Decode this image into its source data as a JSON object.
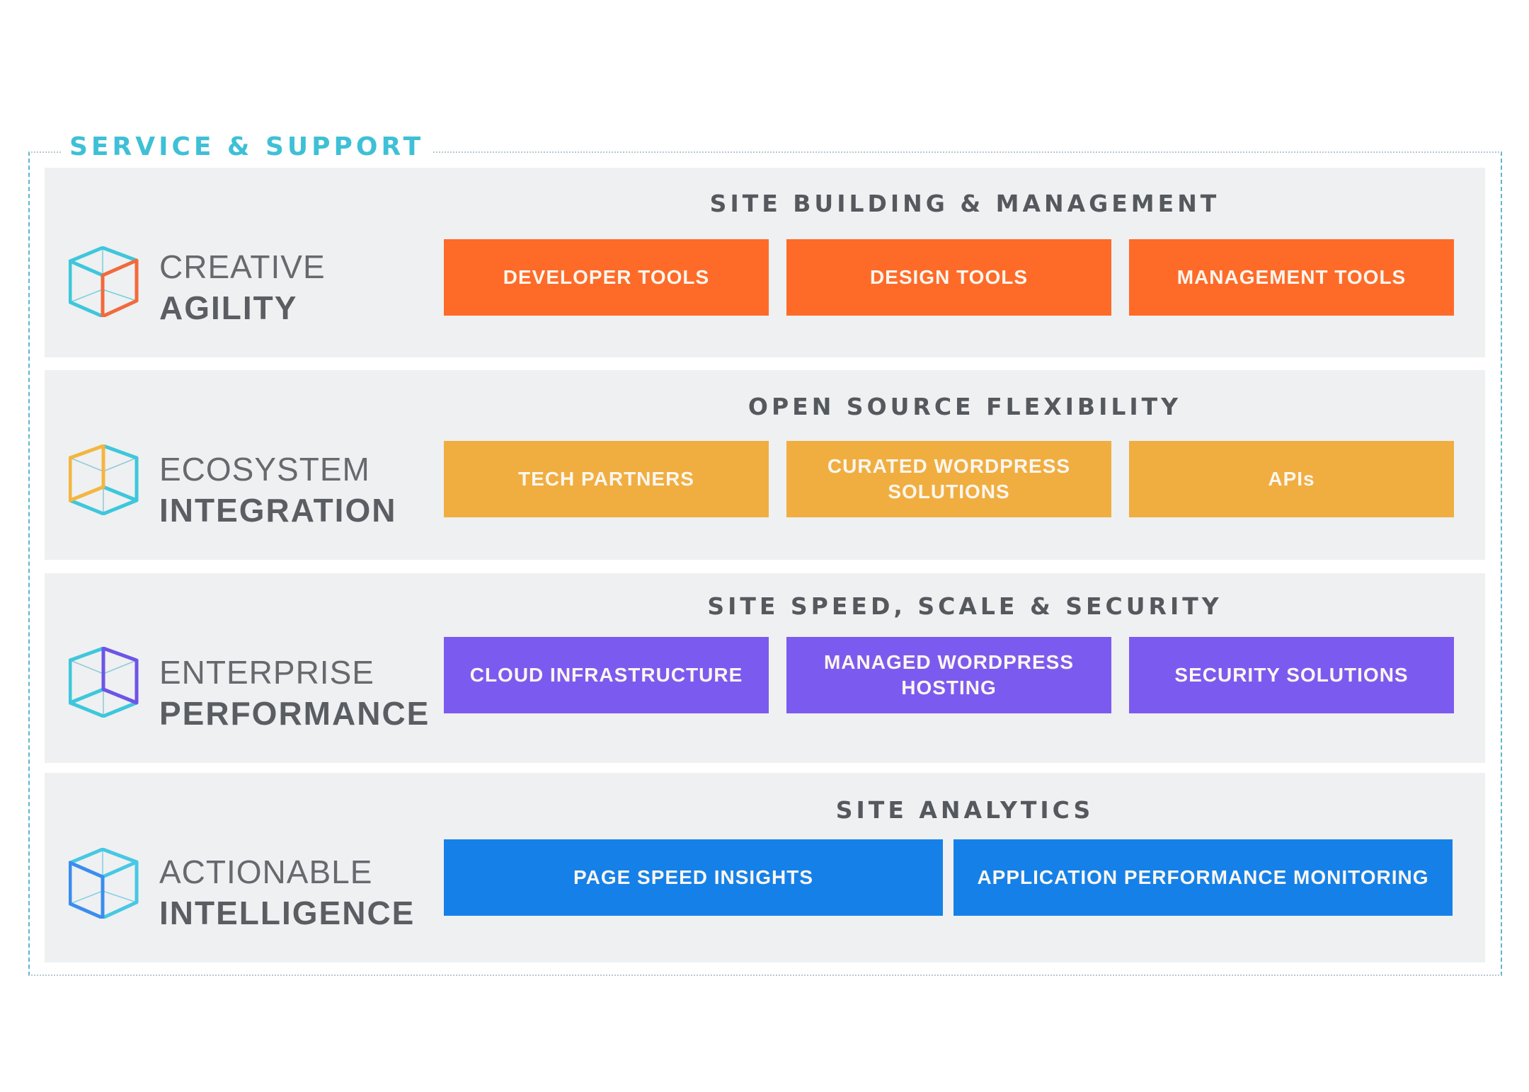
{
  "frame": {
    "title": "SERVICE & SUPPORT",
    "title_color": "#3ec0d6"
  },
  "rows": [
    {
      "label_light": "CREATIVE",
      "label_bold": "AGILITY",
      "icon": "cube-icon",
      "icon_highlight_face": "right",
      "accent": "#fe6b29",
      "section_title": "SITE BUILDING & MANAGEMENT",
      "buttons": [
        {
          "label": "DEVELOPER TOOLS"
        },
        {
          "label": "DESIGN TOOLS"
        },
        {
          "label": "MANAGEMENT TOOLS"
        }
      ]
    },
    {
      "label_light": "ECOSYSTEM",
      "label_bold": "INTEGRATION",
      "icon": "cube-icon",
      "icon_highlight_face": "upper-left",
      "accent": "#f0ae41",
      "section_title": "OPEN SOURCE FLEXIBILITY",
      "buttons": [
        {
          "label": "TECH PARTNERS"
        },
        {
          "label": "CURATED WORDPRESS SOLUTIONS"
        },
        {
          "label": "APIs"
        }
      ]
    },
    {
      "label_light": "ENTERPRISE",
      "label_bold": "PERFORMANCE",
      "icon": "cube-icon",
      "icon_highlight_face": "upper-right",
      "accent": "#7b5bef",
      "section_title": "SITE SPEED, SCALE & SECURITY",
      "buttons": [
        {
          "label": "CLOUD INFRASTRUCTURE"
        },
        {
          "label": "MANAGED WORDPRESS HOSTING"
        },
        {
          "label": "SECURITY SOLUTIONS"
        }
      ]
    },
    {
      "label_light": "ACTIONABLE",
      "label_bold": "INTELLIGENCE",
      "icon": "cube-icon",
      "icon_highlight_face": "left",
      "accent": "#1581e8",
      "section_title": "SITE ANALYTICS",
      "buttons": [
        {
          "label": "PAGE SPEED INSIGHTS"
        },
        {
          "label": "APPLICATION PERFORMANCE MONITORING"
        }
      ]
    }
  ]
}
